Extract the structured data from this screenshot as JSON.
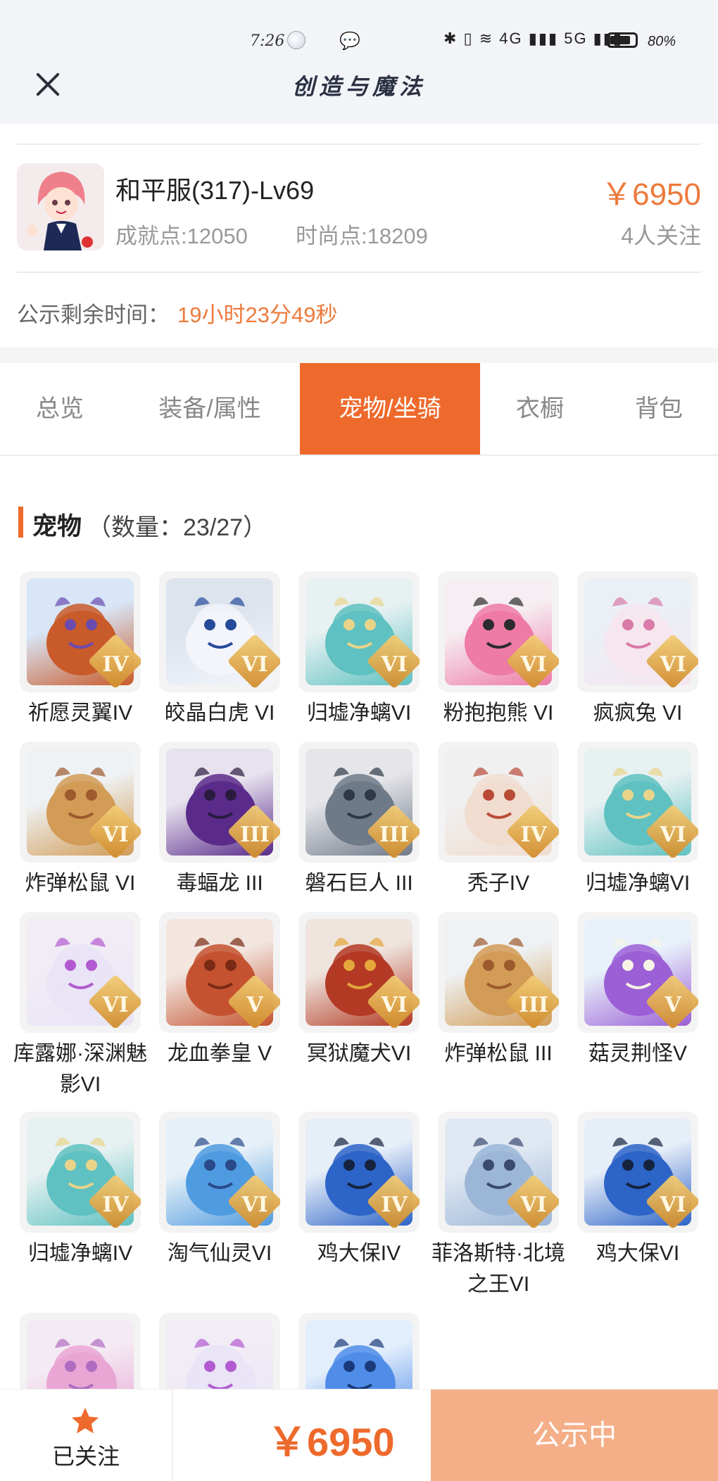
{
  "status_bar": {
    "time": "7:26",
    "network": "✱ ▯ ≋ 4G ▮▮▮ 5G ▮▮▮",
    "battery": "80%"
  },
  "app": {
    "title": "创造与魔法"
  },
  "role": {
    "name": "和平服(317)-Lv69",
    "achievement": "成就点:12050",
    "fashion": "时尚点:18209",
    "price": "￥6950",
    "followers": "4人关注"
  },
  "notice": {
    "label": "公示剩余时间：",
    "time": "19小时23分49秒"
  },
  "tabs": [
    "总览",
    "装备/属性",
    "宠物/坐骑",
    "衣橱",
    "背包"
  ],
  "active_tab": "宠物/坐骑",
  "section": {
    "title": "宠物",
    "count": "（数量：23/27）"
  },
  "pets": [
    {
      "name": "祈愿灵翼IV",
      "grade": "IV"
    },
    {
      "name": "皎晶白虎 VI",
      "grade": "VI"
    },
    {
      "name": "归墟净螭VI",
      "grade": "VI"
    },
    {
      "name": "粉抱抱熊 VI",
      "grade": "VI"
    },
    {
      "name": "疯疯兔 VI",
      "grade": "VI"
    },
    {
      "name": "炸弹松鼠 VI",
      "grade": "VI"
    },
    {
      "name": "毒蝠龙 III",
      "grade": "III"
    },
    {
      "name": "磐石巨人 III",
      "grade": "III"
    },
    {
      "name": "秃子IV",
      "grade": "IV"
    },
    {
      "name": "归墟净螭VI",
      "grade": "VI"
    },
    {
      "name": "库露娜·深渊魅影VI",
      "grade": "VI"
    },
    {
      "name": "龙血拳皇 V",
      "grade": "V"
    },
    {
      "name": "冥狱魔犬VI",
      "grade": "VI"
    },
    {
      "name": "炸弹松鼠 III",
      "grade": "III"
    },
    {
      "name": "菇灵荆怪V",
      "grade": "V"
    },
    {
      "name": "归墟净螭IV",
      "grade": "IV"
    },
    {
      "name": "淘气仙灵VI",
      "grade": "VI"
    },
    {
      "name": "鸡大保IV",
      "grade": "IV"
    },
    {
      "name": "菲洛斯特·北境之王VI",
      "grade": "VI"
    },
    {
      "name": "鸡大保VI",
      "grade": "VI"
    },
    {
      "name": "",
      "grade": ""
    },
    {
      "name": "",
      "grade": ""
    },
    {
      "name": "",
      "grade": ""
    }
  ],
  "bottom": {
    "follow_label": "已关注",
    "price": "￥6950",
    "status_button": "公示中"
  },
  "colors": {
    "accent": "#ee6a2c",
    "price": "#ec7a3c",
    "status_button": "#f4af88"
  }
}
